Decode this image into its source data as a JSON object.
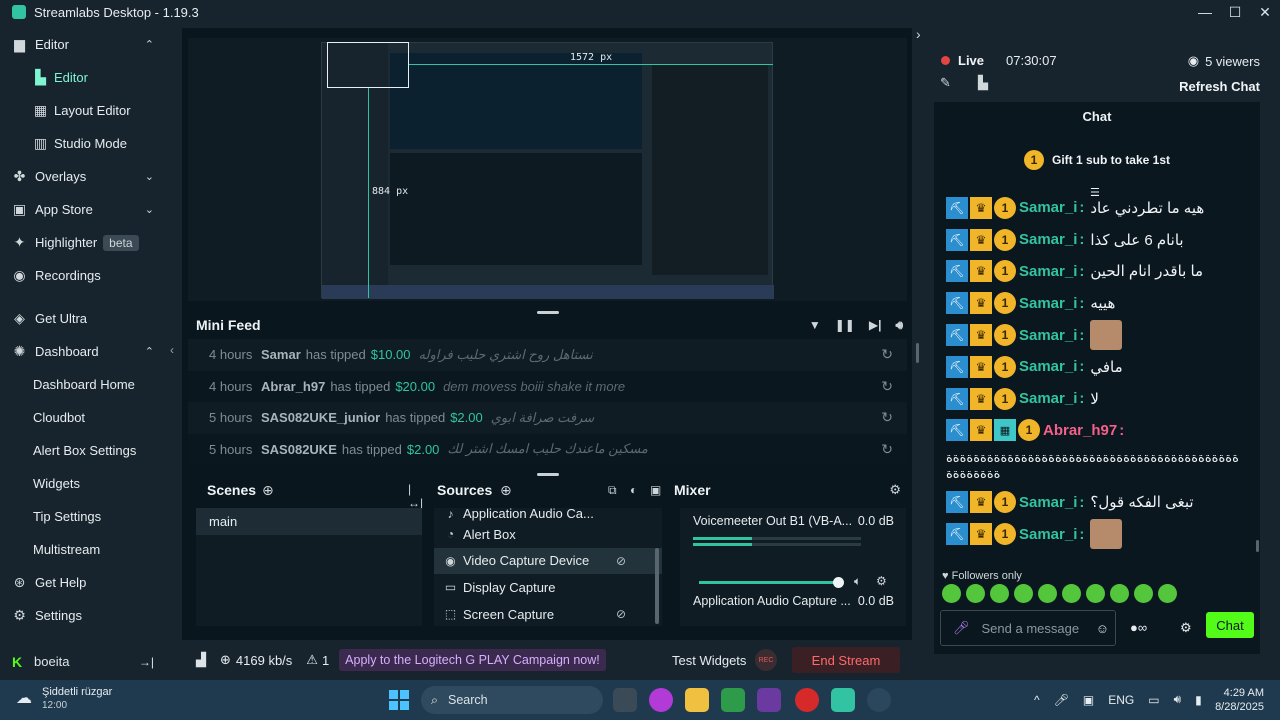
{
  "window": {
    "title": "Streamlabs Desktop - 1.19.3",
    "controls": [
      "—",
      "☐",
      "✕"
    ]
  },
  "sidebar": {
    "items": [
      {
        "label": "Editor",
        "icon": "editor-icon",
        "chev": "^",
        "sub": false
      },
      {
        "label": "Editor",
        "icon": "editor-sub-icon",
        "sub": true,
        "active": true
      },
      {
        "label": "Layout Editor",
        "icon": "layout-icon",
        "sub": true
      },
      {
        "label": "Studio Mode",
        "icon": "studio-icon",
        "sub": true
      },
      {
        "label": "Overlays",
        "icon": "overlays-icon",
        "chev": "v"
      },
      {
        "label": "App Store",
        "icon": "appstore-icon",
        "chev": "v"
      },
      {
        "label": "Highlighter",
        "icon": "highlighter-icon",
        "badge": "beta"
      },
      {
        "label": "Recordings",
        "icon": "recordings-icon"
      },
      {
        "label": "Get Ultra",
        "icon": "ultra-icon"
      },
      {
        "label": "Dashboard",
        "icon": "dashboard-icon",
        "chev": "^"
      },
      {
        "label": "Dashboard Home",
        "sub": true,
        "plain": true
      },
      {
        "label": "Cloudbot",
        "sub": true,
        "plain": true
      },
      {
        "label": "Alert Box Settings",
        "sub": true,
        "plain": true
      },
      {
        "label": "Widgets",
        "sub": true,
        "plain": true
      },
      {
        "label": "Tip Settings",
        "sub": true,
        "plain": true
      },
      {
        "label": "Multistream",
        "sub": true,
        "plain": true
      },
      {
        "label": "Get Help",
        "icon": "help-icon"
      },
      {
        "label": "Settings",
        "icon": "settings-icon"
      }
    ],
    "user": "boeita",
    "logout_icon": "→|"
  },
  "preview": {
    "width_label": "1572 px",
    "height_label": "884 px"
  },
  "minifeed": {
    "title": "Mini Feed",
    "rows": [
      {
        "time": "4 hours",
        "user": "Samar",
        "action": "has tipped",
        "amount": "$10.00",
        "message": "نستاهل روح اشتري حليب فراوله"
      },
      {
        "time": "4 hours",
        "user": "Abrar_h97",
        "action": "has tipped",
        "amount": "$20.00",
        "message": "dem movess boiii shake it more"
      },
      {
        "time": "5 hours",
        "user": "SAS082UKE_junior",
        "action": "has tipped",
        "amount": "$2.00",
        "message": "سرفت صرافة ابوي"
      },
      {
        "time": "5 hours",
        "user": "SAS082UKE",
        "action": "has tipped",
        "amount": "$2.00",
        "message": "مسكين ماعندك حليب امسك اشتر لك"
      }
    ]
  },
  "scenes": {
    "title": "Scenes",
    "items": [
      "main"
    ]
  },
  "sources": {
    "title": "Sources",
    "items": [
      {
        "label": "Application Audio Ca...",
        "icon": "audio-icon"
      },
      {
        "label": "Alert Box",
        "icon": "alert-icon"
      },
      {
        "label": "Video Capture Device",
        "icon": "camera-icon",
        "selected": true,
        "hidden": true
      },
      {
        "label": "Display Capture",
        "icon": "monitor-icon"
      },
      {
        "label": "Screen Capture",
        "icon": "screen-capture-icon",
        "hidden": true
      }
    ]
  },
  "mixer": {
    "title": "Mixer",
    "channels": [
      {
        "name": "Voicemeeter Out B1 (VB-A...",
        "db": "0.0 dB",
        "level": 0.35
      },
      {
        "name": "Application Audio Capture ...",
        "db": "0.0 dB",
        "level": 0
      }
    ]
  },
  "footer": {
    "bitrate": "4169 kb/s",
    "warnings": "1",
    "promo": "Apply to the Logitech G PLAY Campaign now!",
    "test_widgets": "Test Widgets",
    "rec": "REC",
    "end_stream": "End Stream"
  },
  "chat": {
    "live_label": "Live",
    "live_time": "07:30:07",
    "viewers": "5 viewers",
    "refresh": "Refresh Chat",
    "header": "Chat",
    "gift_count": "1",
    "gift_text": "Gift 1 sub to take 1st",
    "messages": [
      {
        "user": "Samar_i",
        "text": "هيه ما تطردني عاد"
      },
      {
        "user": "Samar_i",
        "text": "بانام 6 على كذا"
      },
      {
        "user": "Samar_i",
        "text": "ما باقدر انام الحين"
      },
      {
        "user": "Samar_i",
        "text": "هييه"
      },
      {
        "user": "Samar_i",
        "text": "",
        "emote": true
      },
      {
        "user": "Samar_i",
        "text": "مافي"
      },
      {
        "user": "Samar_i",
        "text": "لا"
      },
      {
        "user": "Abrar_h97",
        "text": "",
        "pink": true,
        "grid": true
      },
      {
        "user": "",
        "long": "ةةةةةةةةةةةةةةةةةةةةةةةةةةةةةةةةةةةةةةةةةةةةةةةةةةة"
      },
      {
        "user": "Samar_i",
        "text": "تبغى الفكه قول؟"
      },
      {
        "user": "Samar_i",
        "text": "",
        "emote": true
      }
    ],
    "followers_only": "Followers only",
    "input_placeholder": "Send a message",
    "extra_icon": "●∞",
    "send": "Chat"
  },
  "taskbar": {
    "weather_name": "Şiddetli rüzgar",
    "weather_temp": "12:00",
    "search": "Search",
    "lang": "ENG",
    "time": "4:29 AM",
    "date": "8/28/2025"
  }
}
